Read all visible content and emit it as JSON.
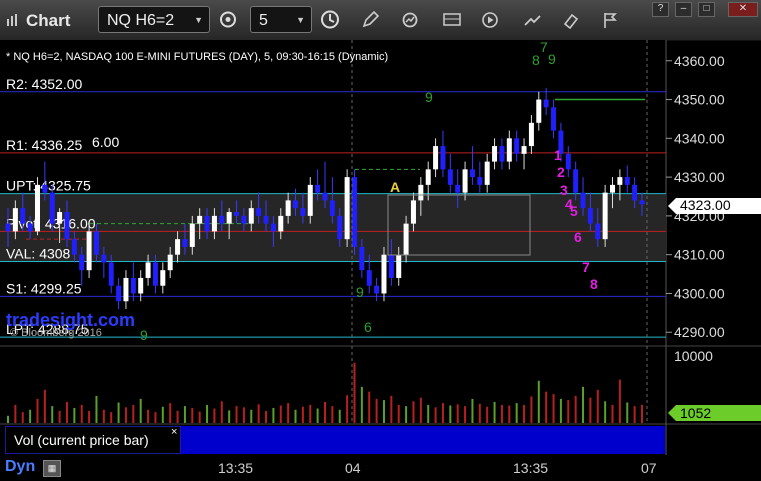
{
  "window": {
    "title": "Chart",
    "symbol": "NQ H6=2",
    "interval": "5",
    "win_buttons": [
      "?",
      "–",
      "□",
      "✕"
    ]
  },
  "toolbar": {
    "icons": [
      "settings-icon",
      "clock-icon",
      "pencil-icon",
      "refresh-icon",
      "grid-icon",
      "play-icon",
      "draw-icon",
      "flag-icon"
    ]
  },
  "chart": {
    "header": "* NQ H6=2, NASDAQ 100 E-MINI FUTURES (DAY), 5, 09:30-16:15 (Dynamic)",
    "price_label": "4323.00",
    "levels": [
      {
        "text": "R2: 4352.00",
        "value": 4352,
        "color": "#2a2ad8"
      },
      {
        "text": "R1: 4336.25",
        "value": 4336.25,
        "color": "#c02020"
      },
      {
        "text": "UPT: 4325.75",
        "value": 4325.75,
        "color": "#20b8c8"
      },
      {
        "text": "Pivot: 4316.00",
        "value": 4316,
        "color": "#c02020"
      },
      {
        "text": "VAL: 4308",
        "value": 4308.25,
        "color": "#20b8c8"
      },
      {
        "text": "S1: 4299.25",
        "value": 4299.25,
        "color": "#2a2ad8"
      },
      {
        "text": "LPT: 4288.75",
        "value": 4288.75,
        "color": "#20b8c8"
      }
    ],
    "overlay_text": "6.00",
    "annotations": {
      "marker_a": "A",
      "seq_magenta": [
        "1",
        "2",
        "3",
        "4",
        "5",
        "6",
        "7",
        "8"
      ],
      "seq_green": [
        "7",
        "8",
        "9",
        "9",
        "9",
        "6",
        "9"
      ]
    },
    "watermark": "tradesight.com",
    "copyright": "© Bloomberg 2016"
  },
  "chart_data": {
    "type": "candlestick",
    "y_ticks": [
      4360,
      4350,
      4340,
      4330,
      4320,
      4310,
      4300,
      4290
    ],
    "ylim": [
      4288,
      4362
    ],
    "x_ticks": [
      "13:35",
      "04",
      "13:35",
      "07"
    ],
    "ohlc": [
      [
        4318,
        4322,
        4312,
        4316
      ],
      [
        4316,
        4324,
        4314,
        4322
      ],
      [
        4322,
        4326,
        4316,
        4318
      ],
      [
        4318,
        4320,
        4314,
        4316
      ],
      [
        4316,
        4330,
        4315,
        4328
      ],
      [
        4328,
        4334,
        4324,
        4326
      ],
      [
        4326,
        4328,
        4316,
        4318
      ],
      [
        4318,
        4322,
        4313,
        4321
      ],
      [
        4321,
        4324,
        4312,
        4314
      ],
      [
        4314,
        4316,
        4308,
        4310
      ],
      [
        4310,
        4312,
        4302,
        4306
      ],
      [
        4306,
        4318,
        4304,
        4316
      ],
      [
        4316,
        4318,
        4308,
        4310
      ],
      [
        4310,
        4312,
        4304,
        4308
      ],
      [
        4308,
        4310,
        4300,
        4302
      ],
      [
        4302,
        4304,
        4296,
        4298
      ],
      [
        4298,
        4306,
        4296,
        4304
      ],
      [
        4304,
        4308,
        4298,
        4300
      ],
      [
        4300,
        4306,
        4298,
        4304
      ],
      [
        4304,
        4310,
        4302,
        4308
      ],
      [
        4308,
        4310,
        4300,
        4302
      ],
      [
        4302,
        4308,
        4300,
        4306
      ],
      [
        4306,
        4312,
        4304,
        4310
      ],
      [
        4310,
        4316,
        4308,
        4314
      ],
      [
        4314,
        4318,
        4310,
        4312
      ],
      [
        4312,
        4320,
        4310,
        4318
      ],
      [
        4318,
        4322,
        4314,
        4320
      ],
      [
        4320,
        4322,
        4314,
        4316
      ],
      [
        4316,
        4322,
        4314,
        4320
      ],
      [
        4320,
        4324,
        4316,
        4318
      ],
      [
        4318,
        4322,
        4314,
        4321
      ],
      [
        4321,
        4324,
        4318,
        4320
      ],
      [
        4320,
        4322,
        4316,
        4318
      ],
      [
        4318,
        4324,
        4316,
        4322
      ],
      [
        4322,
        4326,
        4318,
        4320
      ],
      [
        4320,
        4324,
        4316,
        4318
      ],
      [
        4318,
        4320,
        4312,
        4316
      ],
      [
        4316,
        4322,
        4314,
        4320
      ],
      [
        4320,
        4326,
        4318,
        4324
      ],
      [
        4324,
        4327,
        4320,
        4322
      ],
      [
        4322,
        4326,
        4318,
        4320
      ],
      [
        4320,
        4330,
        4318,
        4328
      ],
      [
        4328,
        4332,
        4324,
        4326
      ],
      [
        4326,
        4334,
        4322,
        4324
      ],
      [
        4324,
        4330,
        4318,
        4320
      ],
      [
        4320,
        4322,
        4312,
        4314
      ],
      [
        4314,
        4332,
        4312,
        4330
      ],
      [
        4330,
        4332,
        4310,
        4312
      ],
      [
        4312,
        4314,
        4304,
        4306
      ],
      [
        4306,
        4310,
        4300,
        4302
      ],
      [
        4302,
        4304,
        4298,
        4300
      ],
      [
        4300,
        4312,
        4298,
        4310
      ],
      [
        4310,
        4314,
        4302,
        4304
      ],
      [
        4304,
        4312,
        4302,
        4310
      ],
      [
        4310,
        4320,
        4308,
        4318
      ],
      [
        4318,
        4326,
        4316,
        4324
      ],
      [
        4324,
        4330,
        4320,
        4328
      ],
      [
        4328,
        4334,
        4324,
        4332
      ],
      [
        4332,
        4340,
        4330,
        4338
      ],
      [
        4338,
        4342,
        4330,
        4332
      ],
      [
        4332,
        4336,
        4326,
        4328
      ],
      [
        4328,
        4332,
        4322,
        4326
      ],
      [
        4326,
        4334,
        4324,
        4332
      ],
      [
        4332,
        4338,
        4328,
        4330
      ],
      [
        4330,
        4334,
        4326,
        4328
      ],
      [
        4328,
        4336,
        4326,
        4334
      ],
      [
        4334,
        4340,
        4332,
        4338
      ],
      [
        4338,
        4340,
        4332,
        4334
      ],
      [
        4334,
        4342,
        4332,
        4340
      ],
      [
        4340,
        4342,
        4334,
        4336
      ],
      [
        4336,
        4340,
        4332,
        4338
      ],
      [
        4338,
        4346,
        4336,
        4344
      ],
      [
        4344,
        4352,
        4342,
        4350
      ],
      [
        4350,
        4353,
        4346,
        4348
      ],
      [
        4348,
        4350,
        4340,
        4342
      ],
      [
        4342,
        4344,
        4334,
        4336
      ],
      [
        4336,
        4338,
        4330,
        4332
      ],
      [
        4332,
        4334,
        4324,
        4326
      ],
      [
        4326,
        4330,
        4320,
        4322
      ],
      [
        4322,
        4326,
        4316,
        4318
      ],
      [
        4318,
        4322,
        4312,
        4314
      ],
      [
        4314,
        4328,
        4312,
        4326
      ],
      [
        4326,
        4330,
        4322,
        4328
      ],
      [
        4328,
        4332,
        4324,
        4330
      ],
      [
        4330,
        4333,
        4326,
        4328
      ],
      [
        4328,
        4330,
        4322,
        4324
      ],
      [
        4324,
        4326,
        4320,
        4323
      ]
    ],
    "volume_ylim": [
      0,
      10000
    ],
    "volume_ticks": [
      10000
    ],
    "volume_label": "1052"
  }
}
